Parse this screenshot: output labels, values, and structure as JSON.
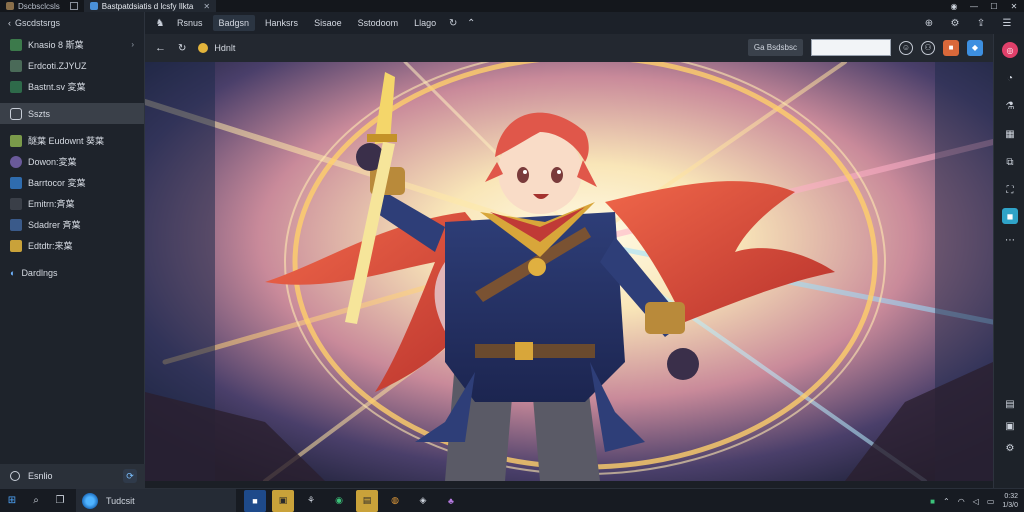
{
  "tabs": [
    {
      "label": "Dscbsclcsls",
      "active": false
    },
    {
      "label": "Bastpatdsiatis d lcsfy Ilkta",
      "active": true
    }
  ],
  "tab_close_glyph": "✕",
  "sidebar": {
    "header": "Gscdstsrgs",
    "items": [
      {
        "label": "Knasio 8 斯葉",
        "icon_color": "#3c7a4b",
        "chevron": "›"
      },
      {
        "label": "Erdcoti.ZJYUZ",
        "icon_color": "#4a6a58"
      },
      {
        "label": "Bastnt.sv 変葉",
        "icon_color": "#2e6a4a"
      },
      {
        "label": "Sszts",
        "icon_color": "#404651",
        "selected": true
      },
      {
        "label": "醚葉 Eudownt 葵葉",
        "icon_color": "#7a9a4a"
      },
      {
        "label": "Dowon:変葉",
        "icon_color": "#6a5a9a"
      },
      {
        "label": "Barrtocor 変葉",
        "icon_color": "#2f6cae"
      },
      {
        "label": "Emitrn:斉葉",
        "icon_color": "#3a3f48"
      },
      {
        "label": "Sdadrer 斉葉",
        "icon_color": "#3a5a8a"
      },
      {
        "label": "Edtdtr:来葉",
        "icon_color": "#c9a23a"
      }
    ],
    "section": "Dardlngs",
    "footer_label": "Esnlio",
    "footer_btn": "⟳"
  },
  "topnav": {
    "items": [
      {
        "label": "Rsnus",
        "active": false
      },
      {
        "label": "Badgsn",
        "active": true
      },
      {
        "label": "Hanksrs",
        "active": false
      },
      {
        "label": "Sisaoe",
        "active": false
      },
      {
        "label": "Sstodoom",
        "active": false
      },
      {
        "label": "Llago",
        "active": false
      }
    ]
  },
  "addressbar": {
    "site_label": "Hdnlt",
    "label_chip": "Ga Bsdsbsc",
    "input_value": "",
    "input_placeholder": ""
  },
  "taskbar": {
    "search_label": "Tudcsit",
    "time": "0:32",
    "date": "1/3/0"
  },
  "colors": {
    "accent": "#3d8fe0",
    "sidebar_bg": "#1e232b"
  }
}
